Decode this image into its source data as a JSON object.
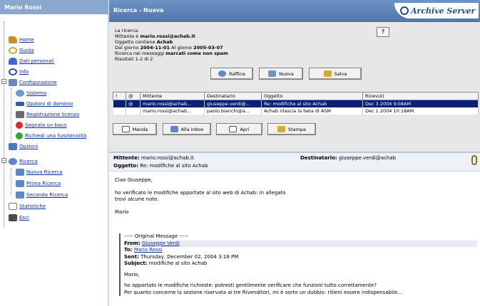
{
  "left_panel": {
    "title": "Mario Rossi",
    "items": [
      {
        "label": "Home",
        "icon": "home-icon",
        "color": "#c8902a"
      },
      {
        "label": "Guida",
        "icon": "help-icon",
        "color": "#d2a82c"
      },
      {
        "label": "Dati personali",
        "icon": "user-icon",
        "color": "#3b6ad0"
      },
      {
        "label": "Info",
        "icon": "info-icon",
        "color": "#2c4fa8"
      },
      {
        "label": "Configurazione",
        "icon": "config-icon",
        "color": "#6c88b8"
      },
      {
        "label": "Sistema",
        "icon": "system-icon",
        "color": "#6b9bd0"
      },
      {
        "label": "Opzioni di dominio",
        "icon": "domain-icon",
        "color": "#2f5ea8"
      },
      {
        "label": "Registrazione licenza",
        "icon": "license-icon",
        "color": "#6b6b6b"
      },
      {
        "label": "Segnala un baco",
        "icon": "bug-icon",
        "color": "#d62b2b"
      },
      {
        "label": "Richiedi una funzionalità",
        "icon": "feature-icon",
        "color": "#2ea83b"
      },
      {
        "label": "Opzioni",
        "icon": "options-icon",
        "color": "#4c78c0"
      },
      {
        "label": "Ricerca",
        "icon": "search-icon",
        "color": "#5d88c8"
      },
      {
        "label": "Nuova Ricerca",
        "icon": "new-search-icon",
        "color": "#5d88c8"
      },
      {
        "label": "Prima Ricerca",
        "icon": "saved-search-icon",
        "color": "#5d88c8"
      },
      {
        "label": "Seconda Ricerca",
        "icon": "saved-search-icon",
        "color": "#5d88c8"
      },
      {
        "label": "Statistiche",
        "icon": "stats-icon",
        "color": "#7a7a7a"
      },
      {
        "label": "Esci",
        "icon": "exit-icon",
        "color": "#4a4a4a"
      }
    ]
  },
  "header": {
    "title": "Ricerca - Nuova",
    "logo_text": "Archive Server"
  },
  "search": {
    "line1": "La ricerca:",
    "line2_prefix": "Mittente è ",
    "line2_value": "mario.rossi@achab.it",
    "line3_prefix": "Oggetto contiene ",
    "line3_value": "Achab",
    "line4_prefix": "Dal giorno ",
    "line4_from": "2004-11-01",
    "line4_mid": " Al giorno ",
    "line4_to": "2005-03-07",
    "line5_prefix": "Ricerca nei messaggi ",
    "line5_value": "marcati come non spam",
    "results_count": "Risultati 1-2 di 2",
    "buttons": {
      "refine": "Raffina",
      "new": "Nuova",
      "save": "Salva"
    }
  },
  "table": {
    "columns": [
      "!",
      "@",
      "Mittente",
      "Destinatario",
      "Oggetto",
      "Ricevuti"
    ],
    "rows": [
      {
        "flag": "",
        "att": "@",
        "from": "mario.rossi@achab...",
        "to": "giuseppe.verdi@...",
        "subject": "Re: modifiche al sito Achab",
        "received": "Dec 3 2004 9:08AM",
        "selected": true
      },
      {
        "flag": "",
        "att": "",
        "from": "mario.rossi@achab...",
        "to": "paolo.bianchi@a...",
        "subject": "Achab rilascia la beta di ASM",
        "received": "Dec 1 2004 10:18AM",
        "selected": false
      }
    ]
  },
  "actions": {
    "send": "Manda",
    "inbox": "Alla Inbox",
    "open": "Apri",
    "print": "Stampa"
  },
  "message": {
    "from_label": "Mittente:",
    "from_value": "mario.rossi@achab.it",
    "to_label": "Destinatario:",
    "to_value": "giuseppe.verdi@achab",
    "subject_label": "Oggetto:",
    "subject_value": "Re: modifiche al sito Achab",
    "greeting": "Ciao Giuseppe,",
    "body1": "ho verificato le modifiche apportate al sito web di Achab: in allegato",
    "body2": "trovi alcune note.",
    "sign": "Mario",
    "quote": {
      "separator": "----- Original Message -----",
      "from_label": "From:",
      "from_value": "Giuseppe Verdi",
      "to_label": "To:",
      "to_value": "Mario Rossi",
      "sent_label": "Sent:",
      "sent_value": "Thursday, December 02, 2004 3:18 PM",
      "subject_label": "Subject:",
      "subject_value": "modifiche al sito Achab",
      "greeting": "Mario,",
      "body1": "ho apportato le modifiche richieste: potresti gentilmente verificare che funzioni tutto correttamente?",
      "body2": "Per quanto concerne la sezione riservata ai tre Rivenditori, mi è sorto un dubbio: ritieni essere indispensabile..."
    }
  }
}
